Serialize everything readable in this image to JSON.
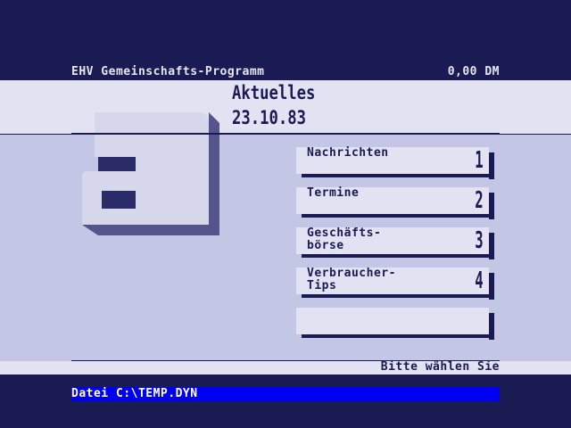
{
  "header": {
    "program_title": "EHV Gemeinschafts-Programm",
    "price": "0,00 DM"
  },
  "page": {
    "title": "Aktuelles",
    "date": "23.10.83"
  },
  "logo": {
    "letter": "a",
    "icon": "block-letter-a-logo"
  },
  "menu": {
    "items": [
      {
        "label_line1": "Nachrichten",
        "label_line2": "",
        "number": "1"
      },
      {
        "label_line1": "Termine",
        "label_line2": "",
        "number": "2"
      },
      {
        "label_line1": "Geschäfts-",
        "label_line2": "börse",
        "number": "3"
      },
      {
        "label_line1": "Verbraucher-",
        "label_line2": "Tips",
        "number": "4"
      },
      {
        "label_line1": "",
        "label_line2": "",
        "number": ""
      }
    ]
  },
  "status": {
    "prompt": "Bitte wählen Sie"
  },
  "file": {
    "label": "Datei C:\\TEMP.DYN"
  },
  "colors": {
    "navy": "#1b1b54",
    "light_band": "#e2e2f2",
    "content_bg": "#c3c6e4",
    "file_bar": "#0000f0"
  }
}
